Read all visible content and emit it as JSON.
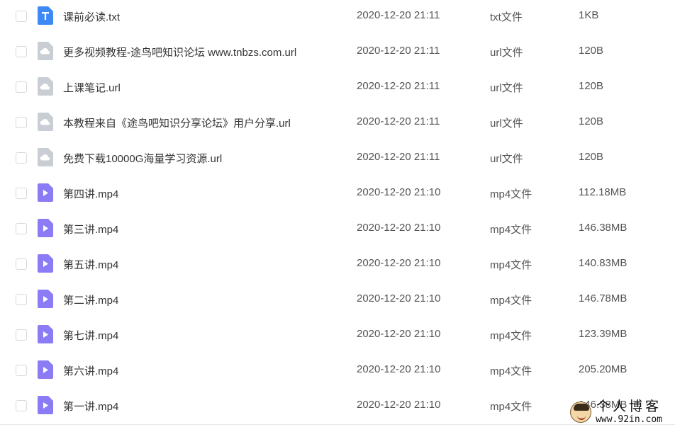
{
  "files": [
    {
      "name": "课前必读.txt",
      "date": "2020-12-20 21:11",
      "type": "txt文件",
      "size": "1KB",
      "icon": "txt-file-icon"
    },
    {
      "name": "更多视频教程-途鸟吧知识论坛 www.tnbzs.com.url",
      "date": "2020-12-20 21:11",
      "type": "url文件",
      "size": "120B",
      "icon": "url-file-icon"
    },
    {
      "name": "上课笔记.url",
      "date": "2020-12-20 21:11",
      "type": "url文件",
      "size": "120B",
      "icon": "url-file-icon"
    },
    {
      "name": "本教程来自《途鸟吧知识分享论坛》用户分享.url",
      "date": "2020-12-20 21:11",
      "type": "url文件",
      "size": "120B",
      "icon": "url-file-icon"
    },
    {
      "name": "免费下载10000G海量学习资源.url",
      "date": "2020-12-20 21:11",
      "type": "url文件",
      "size": "120B",
      "icon": "url-file-icon"
    },
    {
      "name": "第四讲.mp4",
      "date": "2020-12-20 21:10",
      "type": "mp4文件",
      "size": "112.18MB",
      "icon": "video-file-icon"
    },
    {
      "name": "第三讲.mp4",
      "date": "2020-12-20 21:10",
      "type": "mp4文件",
      "size": "146.38MB",
      "icon": "video-file-icon"
    },
    {
      "name": "第五讲.mp4",
      "date": "2020-12-20 21:10",
      "type": "mp4文件",
      "size": "140.83MB",
      "icon": "video-file-icon"
    },
    {
      "name": "第二讲.mp4",
      "date": "2020-12-20 21:10",
      "type": "mp4文件",
      "size": "146.78MB",
      "icon": "video-file-icon"
    },
    {
      "name": "第七讲.mp4",
      "date": "2020-12-20 21:10",
      "type": "mp4文件",
      "size": "123.39MB",
      "icon": "video-file-icon"
    },
    {
      "name": "第六讲.mp4",
      "date": "2020-12-20 21:10",
      "type": "mp4文件",
      "size": "205.20MB",
      "icon": "video-file-icon"
    },
    {
      "name": "第一讲.mp4",
      "date": "2020-12-20 21:10",
      "type": "mp4文件",
      "size": "146.38MB",
      "icon": "video-file-icon"
    }
  ],
  "watermark": {
    "title": "个人博客",
    "url": "www.92in.com"
  },
  "colors": {
    "txt_icon": "#3d8af7",
    "url_icon": "#c9cdd4",
    "video_icon": "#8b7cf6"
  }
}
